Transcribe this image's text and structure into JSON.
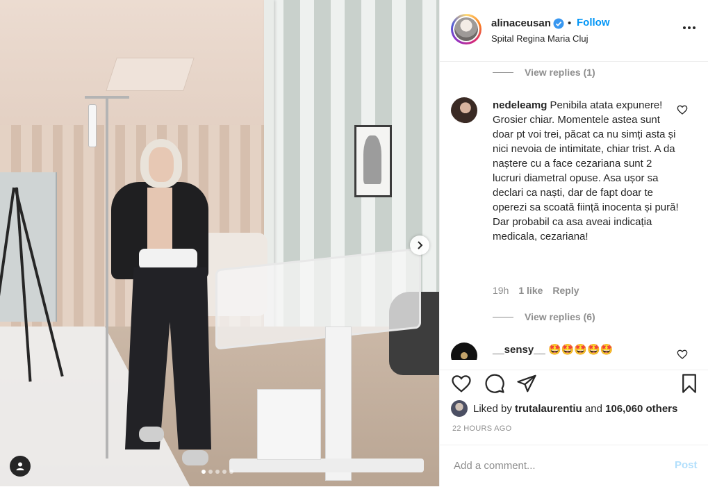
{
  "post": {
    "username": "alinaceusan",
    "follow_label": "Follow",
    "separator": "•",
    "location": "Spital Regina Maria Cluj",
    "image_alt": "Woman standing next to an IV pole and a hospital bassinet in a striped hospital room",
    "carousel_count": 5,
    "carousel_active": 0
  },
  "comments": {
    "view_replies_1": "View replies (1)",
    "items": [
      {
        "username": "nedeleamg",
        "text": "Penibila atata expunere! Grosier chiar. Momentele astea sunt doar pt voi trei, păcat ca nu simți asta și nici nevoia de intimitate, chiar trist. A da naștere cu a face cezariana sunt 2 lucruri diametral opuse. Asa ușor sa declari ca naști, dar de fapt doar te operezi sa scoată ființă inocenta și pură! Dar probabil ca asa aveai indicația medicala, cezariana!",
        "time": "19h",
        "likes": "1 like",
        "reply": "Reply"
      },
      {
        "username": "__sensy__",
        "text": "🤩🤩🤩🤩🤩"
      }
    ],
    "view_replies_2": "View replies (6)"
  },
  "likes": {
    "prefix": "Liked by",
    "user": "trutalaurentiu",
    "and": "and",
    "others": "106,060 others"
  },
  "timestamp": "22 HOURS AGO",
  "add_comment": {
    "placeholder": "Add a comment...",
    "post_label": "Post"
  },
  "colors": {
    "accent": "#0095f6",
    "post_disabled": "#b2dffc",
    "muted": "#8e8e8e",
    "text": "#262626"
  },
  "icons": [
    "chevron-right-icon",
    "user-tag-icon",
    "verified-badge-icon",
    "more-options-icon",
    "heart-icon",
    "comment-icon",
    "share-icon",
    "bookmark-icon"
  ]
}
